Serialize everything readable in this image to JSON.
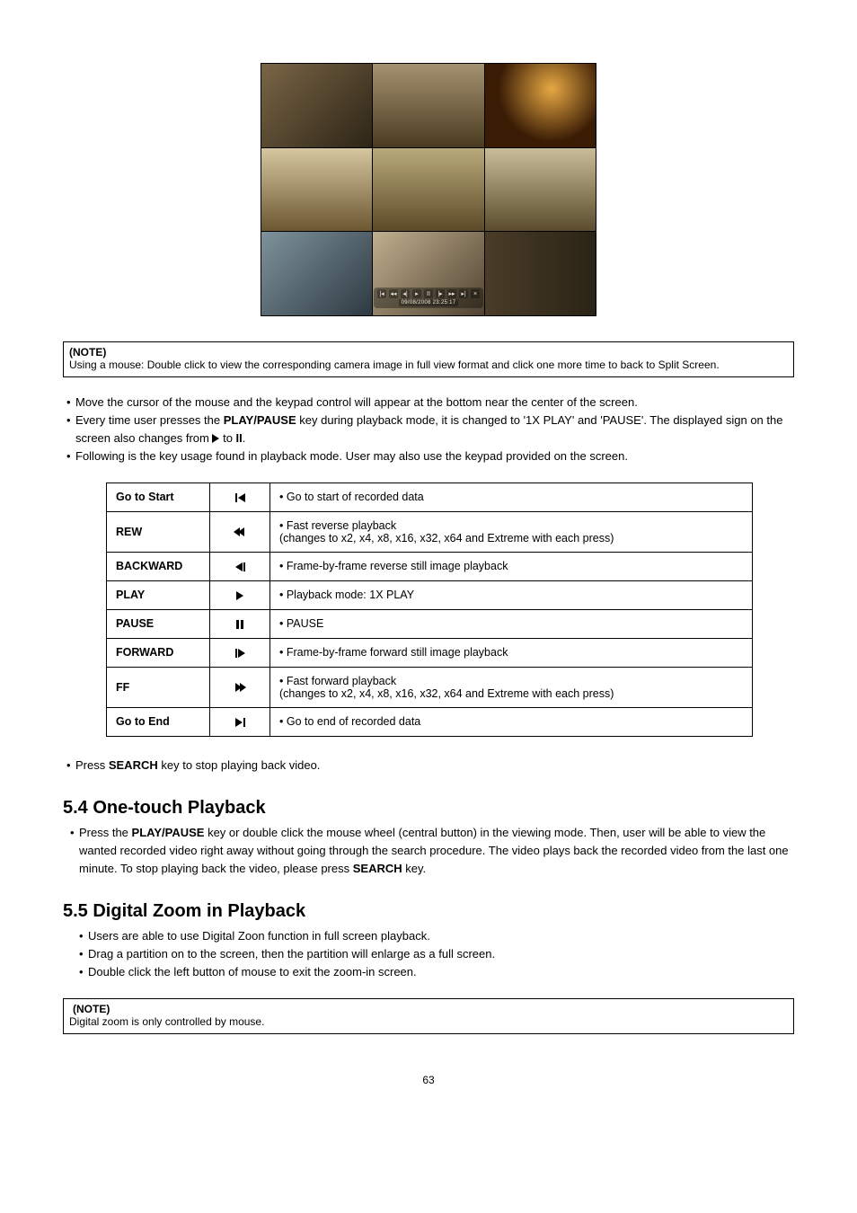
{
  "screenshot": {
    "osd_time": "09/08/2008 23:25:17"
  },
  "note1": {
    "title": "(NOTE)",
    "body": "Using a mouse: Double click to view the corresponding camera image in full view format and click one more time to back to Split Screen."
  },
  "bullets1": [
    "Move the cursor of the mouse and the keypad control will appear at the bottom near the center of the screen.",
    "Every time user presses the <b>PLAY/PAUSE</b> key during playback mode, it is changed to '1X PLAY' and 'PAUSE'. The displayed sign on the screen also changes from <span class=\"tri-right\"></span> to <b>II</b>.",
    "Following is the key usage found in playback mode. User may also use the keypad provided on the screen."
  ],
  "table": [
    {
      "name": "Go to Start",
      "symKey": "gotostart",
      "desc": "• Go to start of recorded data"
    },
    {
      "name": "REW",
      "symKey": "rew",
      "desc": "• Fast reverse playback<br>(changes to x2, x4, x8, x16, x32, x64 and Extreme with each press)"
    },
    {
      "name": "BACKWARD",
      "symKey": "backward",
      "desc": "• Frame-by-frame reverse still image playback"
    },
    {
      "name": "PLAY",
      "symKey": "play",
      "desc": "• Playback mode: 1X PLAY"
    },
    {
      "name": "PAUSE",
      "symKey": "pause",
      "desc": "• PAUSE"
    },
    {
      "name": "FORWARD",
      "symKey": "forward",
      "desc": "• Frame-by-frame forward still image playback"
    },
    {
      "name": "FF",
      "symKey": "ff",
      "desc": "• Fast forward playback<br>(changes to x2, x4, x8, x16, x32, x64 and Extreme with each press)"
    },
    {
      "name": "Go to End",
      "symKey": "gotoend",
      "desc": "• Go to end of recorded data"
    }
  ],
  "after_table_bullet": "Press <b>SEARCH</b> key to stop playing back video.",
  "sec54": {
    "title": "5.4  One-touch Playback",
    "body": "Press the <b>PLAY/PAUSE</b> key or double click the mouse wheel (central button) in the viewing mode. Then, user will be able to view the wanted recorded video right away without going through the search procedure. The video plays back the recorded video from the last one minute. To stop playing back the video, please press <b>SEARCH</b> key."
  },
  "sec55": {
    "title": "5.5  Digital Zoom in Playback",
    "bullets": [
      "Users are able to use Digital Zoon function in full screen playback.",
      "Drag a partition on to the screen, then the partition will enlarge as a full screen.",
      "Double click the left button of mouse to exit the zoom-in screen."
    ]
  },
  "note2": {
    "title": "(NOTE)",
    "body": "Digital zoom is only controlled by mouse."
  },
  "page_number": "63"
}
